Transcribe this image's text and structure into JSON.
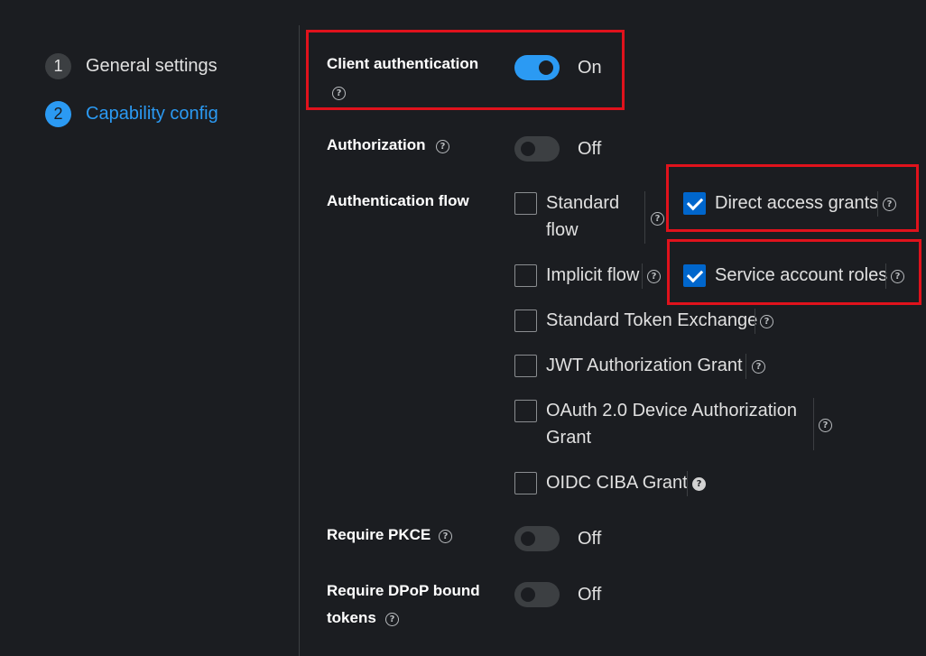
{
  "wizard": {
    "steps": [
      {
        "number": "1",
        "label": "General settings"
      },
      {
        "number": "2",
        "label": "Capability config"
      }
    ]
  },
  "form": {
    "client_authentication": {
      "label": "Client authentication",
      "state": "On"
    },
    "authorization": {
      "label": "Authorization",
      "state": "Off"
    },
    "authentication_flow": {
      "label": "Authentication flow",
      "options": {
        "standard_flow": {
          "line1": "Standard",
          "line2": "flow",
          "checked": false
        },
        "direct_access_grants": {
          "label": "Direct access grants",
          "checked": true
        },
        "implicit_flow": {
          "label": "Implicit flow",
          "checked": false
        },
        "service_account_roles": {
          "label": "Service account roles",
          "checked": true
        },
        "standard_token_exchange": {
          "label": "Standard Token Exchange",
          "checked": false
        },
        "jwt_authorization_grant": {
          "label": "JWT Authorization Grant",
          "checked": false
        },
        "oauth_device_grant": {
          "line1": "OAuth 2.0 Device Authorization",
          "line2": "Grant",
          "checked": false
        },
        "oidc_ciba_grant": {
          "label": "OIDC CIBA Grant",
          "checked": false
        }
      }
    },
    "require_pkce": {
      "label": "Require PKCE",
      "state": "Off"
    },
    "require_dpop": {
      "line1": "Require DPoP bound",
      "line2": "tokens",
      "state": "Off"
    }
  },
  "help_glyph": "?",
  "colors": {
    "background": "#1b1d21",
    "accent": "#2b9af3",
    "checkbox_checked": "#0066cc",
    "highlight_box": "#e0121c"
  }
}
